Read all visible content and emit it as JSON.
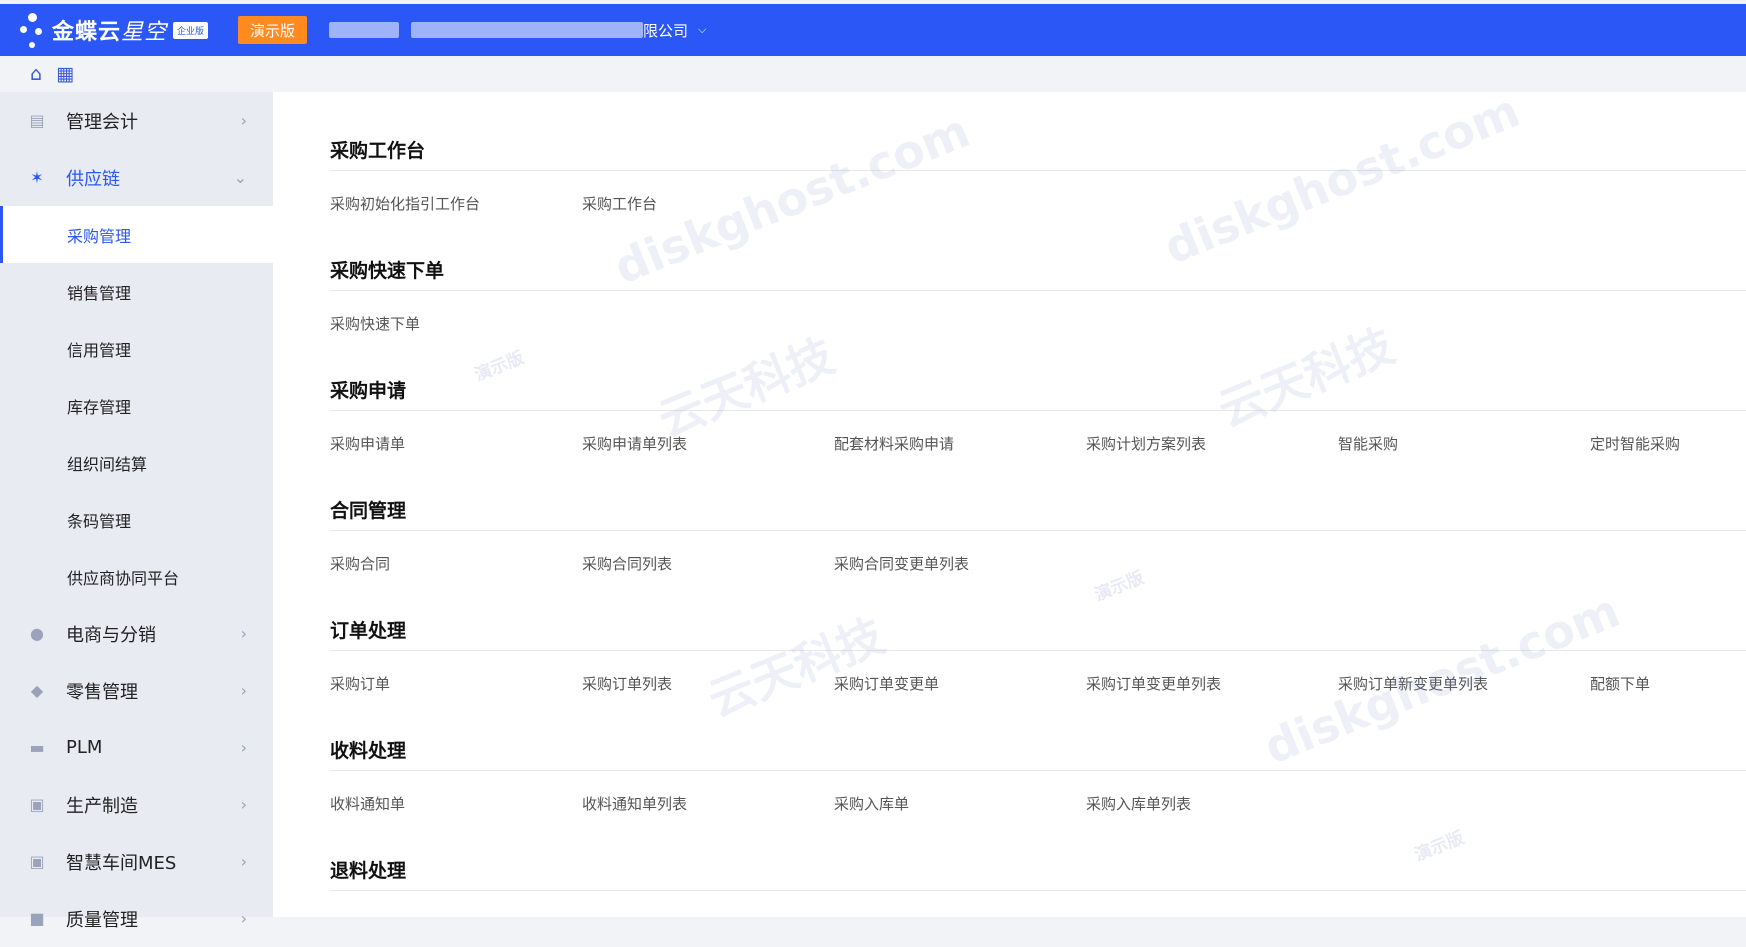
{
  "header": {
    "logo_main": "金蝶云",
    "logo_sub": "星空",
    "edition": "企业版",
    "demo": "演示版",
    "company_suffix": "限公司",
    "company_chevron": "chevron-down-icon"
  },
  "toolbar": {
    "home_icon": "home-icon",
    "apps_icon": "apps-icon"
  },
  "sidebar": {
    "items": [
      {
        "label": "管理会计",
        "icon": "ledger-icon"
      },
      {
        "label": "供应链",
        "icon": "network-icon",
        "open": true
      },
      {
        "label": "电商与分销",
        "icon": "shop-icon"
      },
      {
        "label": "零售管理",
        "icon": "layers-icon"
      },
      {
        "label": "PLM",
        "icon": "plm-icon"
      },
      {
        "label": "生产制造",
        "icon": "factory-icon"
      },
      {
        "label": "智慧车间MES",
        "icon": "workshop-icon"
      },
      {
        "label": "质量管理",
        "icon": "quality-icon"
      }
    ],
    "sub_items": [
      "采购管理",
      "销售管理",
      "信用管理",
      "库存管理",
      "组织间结算",
      "条码管理",
      "供应商协同平台"
    ],
    "active_sub": "采购管理"
  },
  "sections": [
    {
      "title": "采购工作台",
      "links": [
        "采购初始化指引工作台",
        "采购工作台"
      ]
    },
    {
      "title": "采购快速下单",
      "links": [
        "采购快速下单"
      ]
    },
    {
      "title": "采购申请",
      "links": [
        "采购申请单",
        "采购申请单列表",
        "配套材料采购申请",
        "采购计划方案列表",
        "智能采购",
        "定时智能采购"
      ]
    },
    {
      "title": "合同管理",
      "links": [
        "采购合同",
        "采购合同列表",
        "采购合同变更单列表"
      ]
    },
    {
      "title": "订单处理",
      "links": [
        "采购订单",
        "采购订单列表",
        "采购订单变更单",
        "采购订单变更单列表",
        "采购订单新变更单列表",
        "配额下单"
      ]
    },
    {
      "title": "收料处理",
      "links": [
        "收料通知单",
        "收料通知单列表",
        "采购入库单",
        "采购入库单列表"
      ]
    },
    {
      "title": "退料处理",
      "links": []
    }
  ],
  "watermark": {
    "brand": "云天科技",
    "site": "diskghost.com",
    "demo": "演示版"
  }
}
